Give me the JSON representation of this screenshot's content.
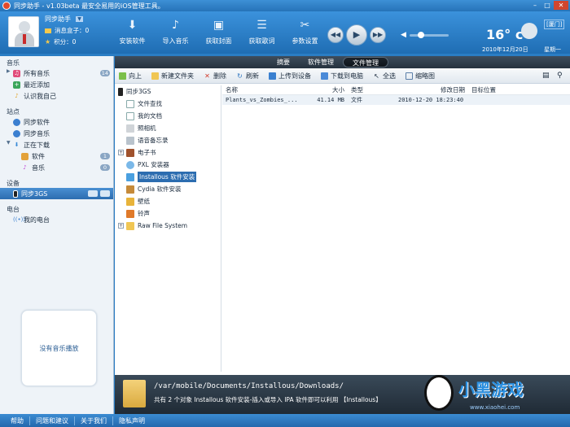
{
  "titlebar": {
    "text": "同步助手 - v1.03beta  最安全易用的iOS管理工具。",
    "min": "–",
    "max": "□",
    "close": "✕"
  },
  "profile": {
    "name": "同步助手",
    "message": "消息盒子：0",
    "points": "积分：0",
    "dropdown_icon": "chevron-down-icon"
  },
  "toolbar": [
    {
      "label": "安装软件",
      "icon": "install-icon"
    },
    {
      "label": "导入音乐",
      "icon": "music-import-icon"
    },
    {
      "label": "获取封面",
      "icon": "cover-icon"
    },
    {
      "label": "获取歌词",
      "icon": "lyrics-icon"
    },
    {
      "label": "参数设置",
      "icon": "settings-icon"
    }
  ],
  "player": {
    "prev": "◀◀",
    "play": "▶",
    "next": "▶▶",
    "volume_level": 0.25
  },
  "weather": {
    "location": "[厦门]",
    "temp": "16° c",
    "date": "2010年12月20日",
    "day": "星期一"
  },
  "sidebar": {
    "music_title": "音乐",
    "music": [
      {
        "label": "所有音乐",
        "badge": "14"
      },
      {
        "label": "最近添加"
      },
      {
        "label": "认识我自己"
      }
    ],
    "site_title": "站点",
    "site": [
      {
        "label": "同步软件"
      },
      {
        "label": "同步音乐"
      },
      {
        "label": "正在下载"
      },
      {
        "label": "软件",
        "badge": "1"
      },
      {
        "label": "音乐",
        "badge": "0"
      }
    ],
    "device_title": "设备",
    "device": {
      "label": "同步3GS"
    },
    "radio_title": "电台",
    "radio": {
      "label": "我的电台"
    },
    "music_box": "没有音乐播放"
  },
  "tabs": [
    {
      "label": "摘要"
    },
    {
      "label": "软件管理"
    },
    {
      "label": "文件管理",
      "active": true
    }
  ],
  "filetoolbar": [
    {
      "label": "向上"
    },
    {
      "label": "新建文件夹"
    },
    {
      "label": "删除"
    },
    {
      "label": "刷新"
    },
    {
      "label": "上传到设备"
    },
    {
      "label": "下载到电脑"
    },
    {
      "label": "全选"
    },
    {
      "label": "缩略图"
    }
  ],
  "tree": {
    "root": "同步3GS",
    "items": [
      "文件查找",
      "我的文档",
      "照相机",
      "语音备忘录",
      "电子书",
      "PXL 安装器",
      "Installous 软件安装",
      "Cydia 软件安装",
      "壁纸",
      "铃声",
      "Raw File System"
    ]
  },
  "filelist": {
    "columns": [
      "名称",
      "大小",
      "类型",
      "修改日期",
      "目标位置"
    ],
    "rows": [
      {
        "name": "Plants_vs_Zombies_...",
        "size": "41.14 MB",
        "type": "文件",
        "date": "2010-12-20 18:23:40",
        "target": ""
      }
    ]
  },
  "info": {
    "path": "/var/mobile/Documents/Installous/Downloads/",
    "desc": "共有 2 个对象  Installous 软件安装-插入或导入 IPA 软件即可以利用 【Installous】"
  },
  "watermark": {
    "brand": "小黑游戏",
    "url": "www.xiaohei.com"
  },
  "statusbar": [
    "帮助",
    "问题和建议",
    "关于我们",
    "隐私声明"
  ]
}
